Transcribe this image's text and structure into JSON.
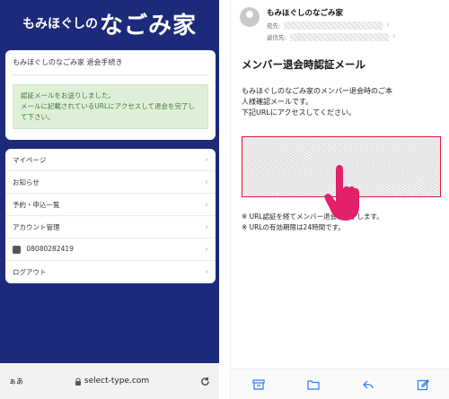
{
  "left": {
    "logo_small": "もみほぐしの",
    "logo_big": "なごみ家",
    "card_title": "もみほぐしのなごみ家 退会手続き",
    "notice_line1": "認証メールをお送りしました。",
    "notice_line2": "メールに記載されているURLにアクセスして退会を完了して下さい。",
    "menu": [
      {
        "label": "マイページ"
      },
      {
        "label": "お知らせ"
      },
      {
        "label": "予約・申込一覧"
      },
      {
        "label": "アカウント管理"
      },
      {
        "label": "08080282419"
      },
      {
        "label": "ログアウト"
      }
    ],
    "urlbar": {
      "text_size": "ぁあ",
      "url": "select-type.com"
    }
  },
  "right": {
    "sender": "もみほぐしのなごみ家",
    "to_label": "宛先:",
    "reply_label": "返信先:",
    "subject": "メンバー退会時認証メール",
    "body_line1": "もみほぐしのなごみ家のメンバー退会時のご本",
    "body_line2": "人様確認メールです。",
    "body_line3": "下記URLにアクセスしてください。",
    "note1": "※ URL認証を経てメンバー退会が完了します。",
    "note2": "※ URLの有効期限は24時間です。"
  },
  "colors": {
    "brand_navy": "#1d2a7a",
    "notice_green": "#dff0d8",
    "highlight_red": "#e0183a",
    "hand_pink": "#e3206a",
    "ios_blue": "#2b7cf6"
  }
}
